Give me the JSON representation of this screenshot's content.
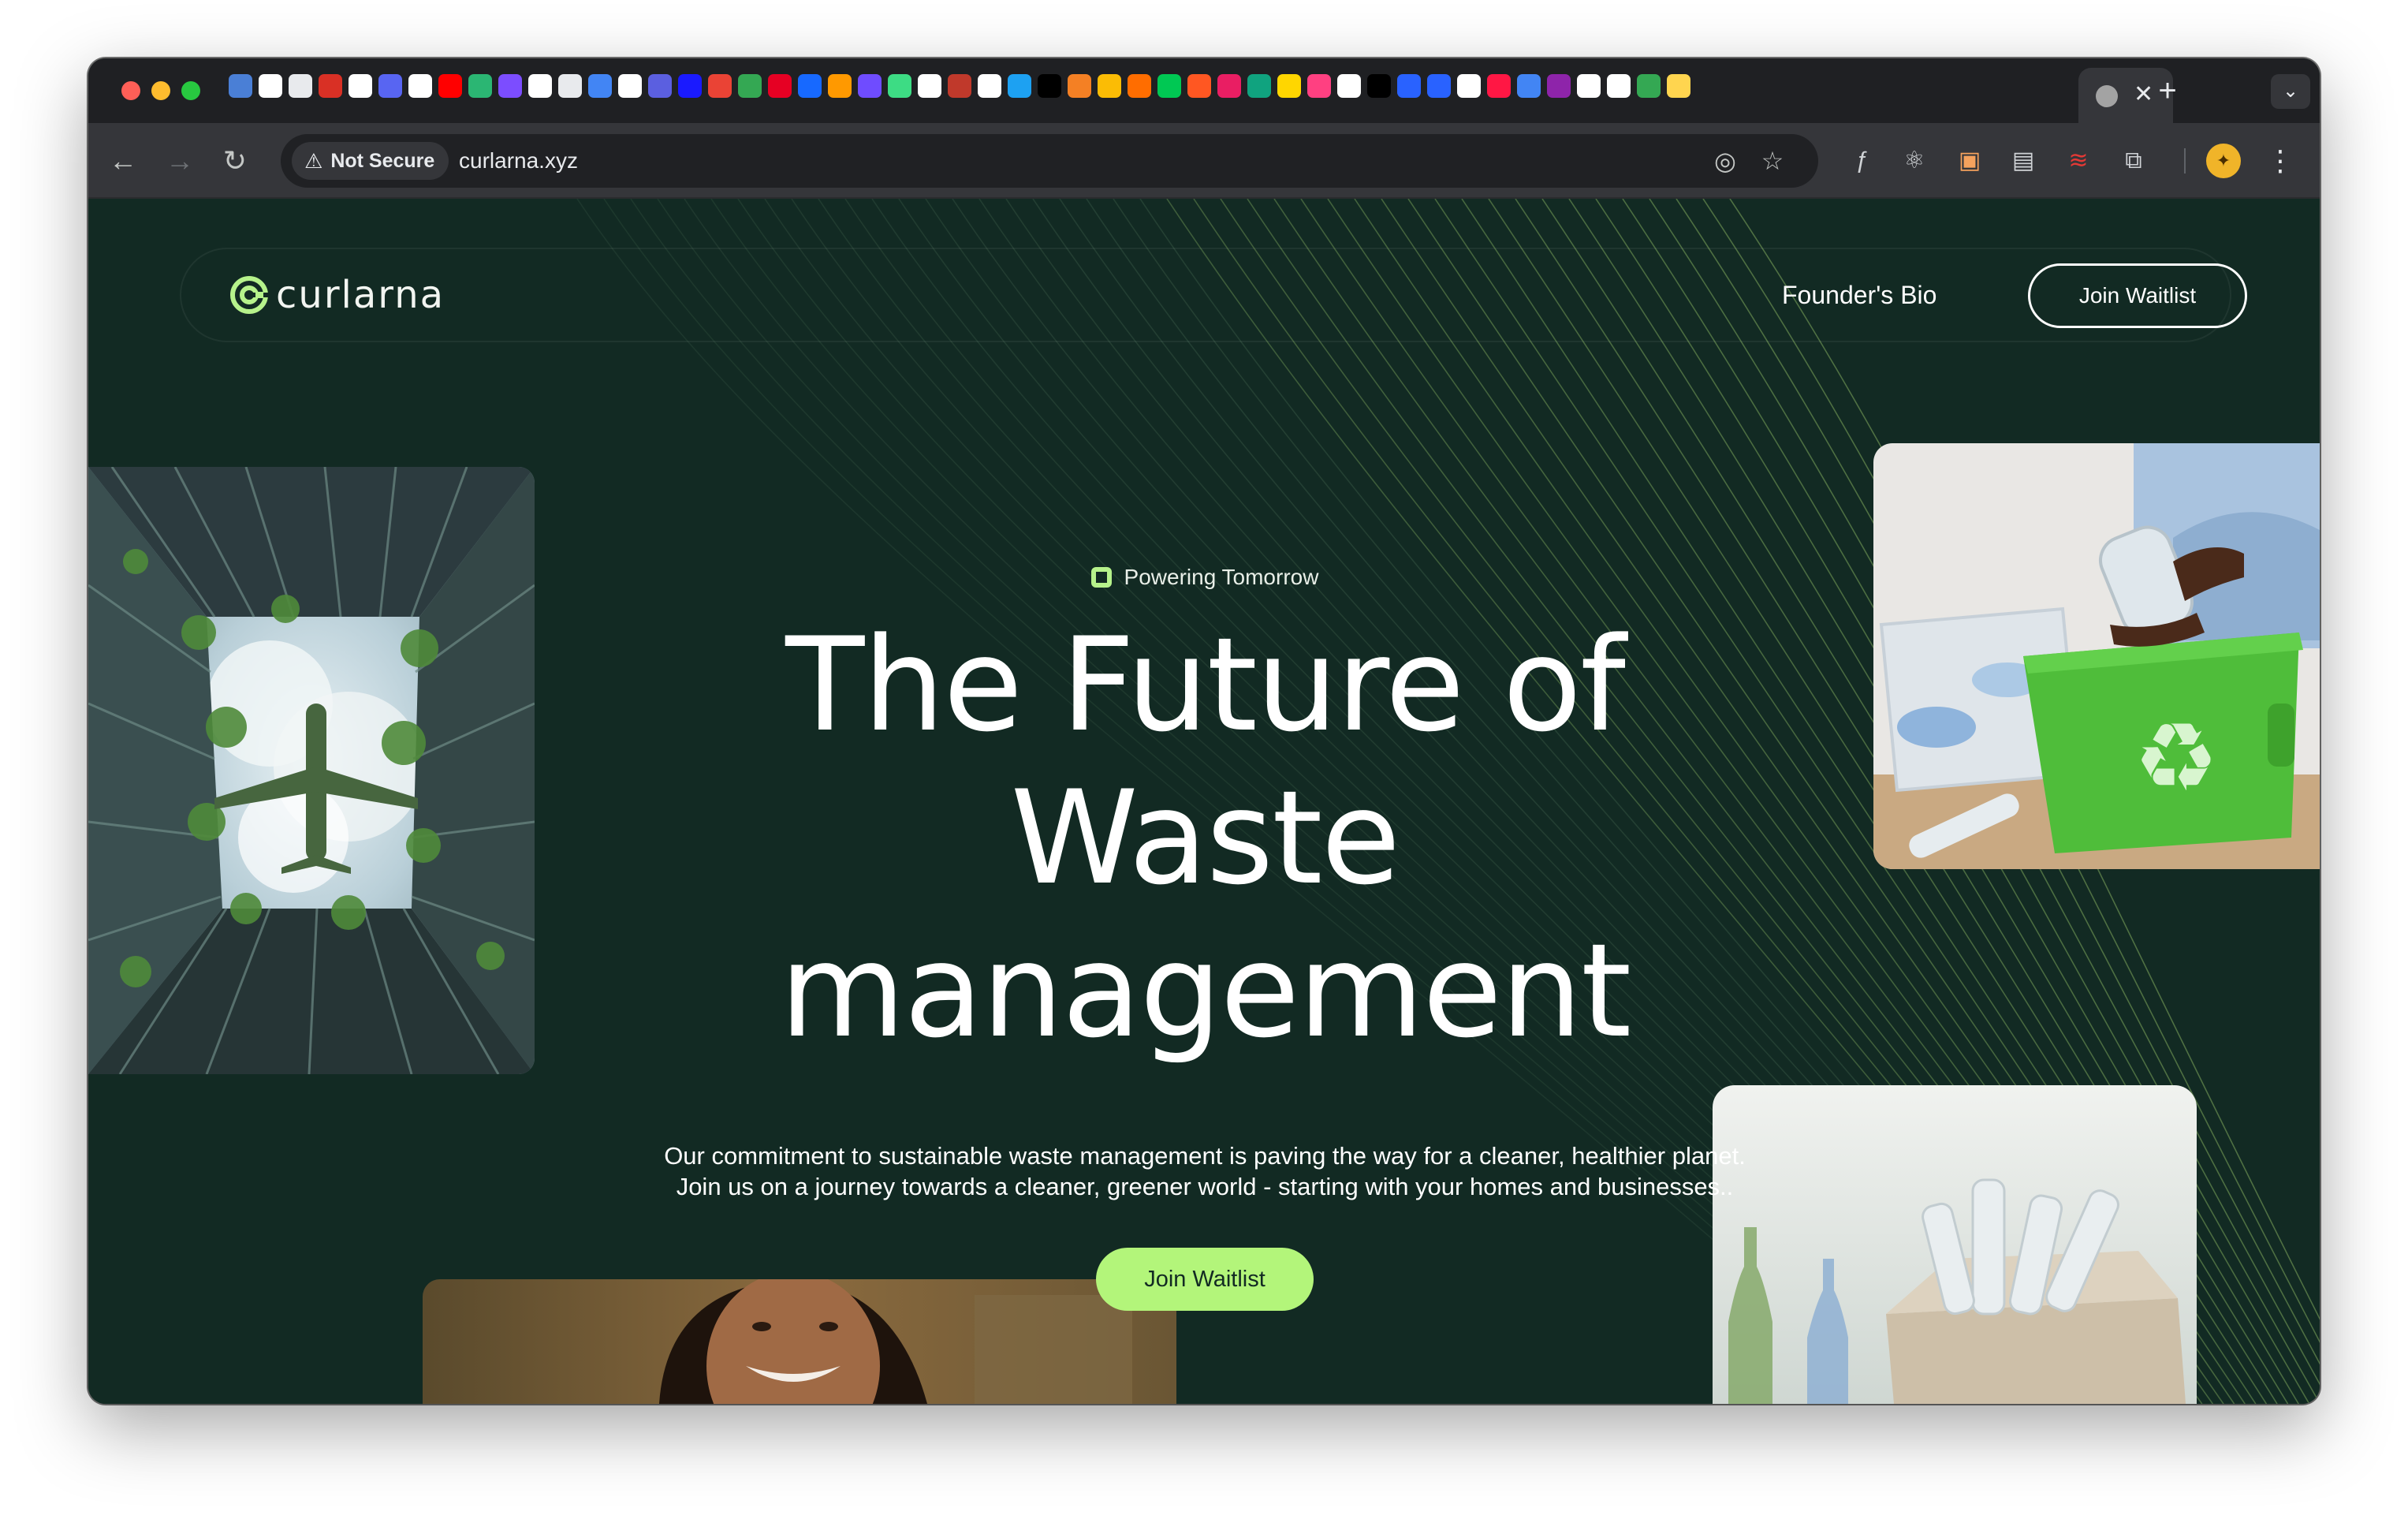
{
  "browser": {
    "security_label": "Not Secure",
    "url": "curlarna.xyz",
    "tab_close": "✕",
    "new_tab": "+",
    "icons": {
      "back": "arrow-left-icon",
      "forward": "arrow-right-icon",
      "reload": "reload-icon",
      "eye_off": "eye-off-icon",
      "bookmark": "star-icon",
      "extensions": "puzzle-icon",
      "menu": "kebab-menu-icon"
    },
    "pinned_tab_colors": [
      "#4a7fd6",
      "#ffffff",
      "#e8eaed",
      "#d93025",
      "#ffffff",
      "#5865f2",
      "#ffffff",
      "#ff0000",
      "#2bb673",
      "#7c4dff",
      "#ffffff",
      "#e8eaed",
      "#4285f4",
      "#ffffff",
      "#5b5fe0",
      "#1a1aff",
      "#ea4335",
      "#34a853",
      "#e60023",
      "#1769ff",
      "#ff9900",
      "#6f4cff",
      "#3ddc84",
      "#ffffff",
      "#c0392b",
      "#ffffff",
      "#1da1f2",
      "#000000",
      "#f48024",
      "#fbbc05",
      "#ff6d00",
      "#00c853",
      "#ff5722",
      "#e91e63",
      "#10a37f",
      "#ffd600",
      "#ff4081",
      "#ffffff",
      "#000000",
      "#2962ff",
      "#2962ff",
      "#ffffff",
      "#ff1744",
      "#4285f4",
      "#8e24aa",
      "#ffffff",
      "#ffffff",
      "#34a853",
      "#ffd54f"
    ]
  },
  "site": {
    "brand": "curlarna",
    "nav": {
      "founder_bio": "Founder's Bio",
      "join_waitlist": "Join Waitlist"
    },
    "hero": {
      "tagline": "Powering Tomorrow",
      "headline_line1": "The Future of",
      "headline_line2": "Waste",
      "headline_line3": "management",
      "subtext_line1": "Our commitment to sustainable waste management is paving the way for a cleaner, healthier planet.",
      "subtext_line2": "Join us on a journey towards a cleaner, greener world - starting with your homes and businesses..",
      "cta": "Join Waitlist"
    },
    "images": {
      "building": "green-buildings-airplane-photo",
      "recycling": "hands-recycling-bin-photo",
      "woman": "smiling-woman-photo",
      "bottles": "plastic-bottles-box-photo"
    },
    "colors": {
      "background": "#122a23",
      "accent": "#b3f57a",
      "logo": "#b6f28b",
      "text": "#ffffff"
    }
  }
}
